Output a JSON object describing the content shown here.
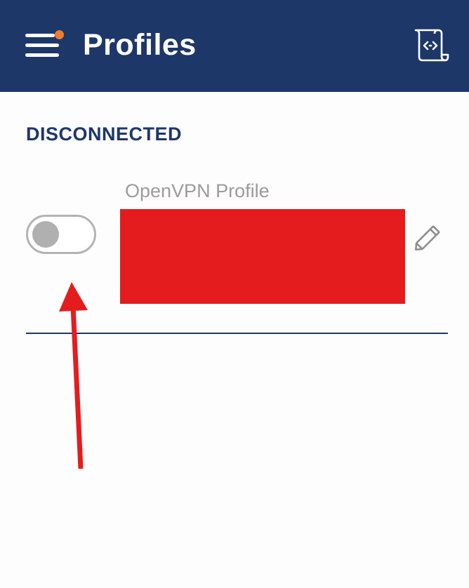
{
  "header": {
    "title": "Profiles",
    "menu_icon": "hamburger-menu-icon",
    "import_icon": "import-profile-icon"
  },
  "status": {
    "label": "DISCONNECTED"
  },
  "profile": {
    "type_label": "OpenVPN Profile",
    "connected": false,
    "edit_icon": "pencil-icon"
  },
  "colors": {
    "header_bg": "#1d3768",
    "accent": "#1d3768",
    "notification_dot": "#ee7d2e",
    "redaction": "#e51c1e",
    "annotation_arrow": "#e51c1e"
  }
}
